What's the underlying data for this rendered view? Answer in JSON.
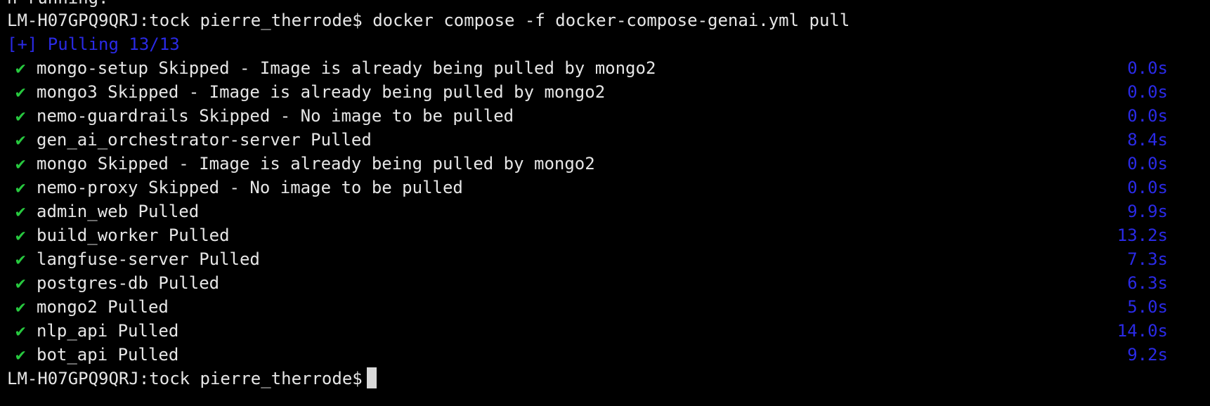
{
  "terminal": {
    "partial_top_line": "n running.",
    "command_line": {
      "prompt": "LM-H07GPQ9QRJ:tock pierre_therrode$",
      "command": "docker compose -f docker-compose-genai.yml pull"
    },
    "pulling_status": "[+] Pulling 13/13",
    "rows": [
      {
        "text": "mongo-setup Skipped - Image is already being pulled by mongo2",
        "duration": "0.0s"
      },
      {
        "text": "mongo3 Skipped - Image is already being pulled by mongo2",
        "duration": "0.0s"
      },
      {
        "text": "nemo-guardrails Skipped - No image to be pulled",
        "duration": "0.0s"
      },
      {
        "text": "gen_ai_orchestrator-server Pulled",
        "duration": "8.4s"
      },
      {
        "text": "mongo Skipped - Image is already being pulled by mongo2",
        "duration": "0.0s"
      },
      {
        "text": "nemo-proxy Skipped - No image to be pulled",
        "duration": "0.0s"
      },
      {
        "text": "admin_web Pulled",
        "duration": "9.9s"
      },
      {
        "text": "build_worker Pulled",
        "duration": "13.2s"
      },
      {
        "text": "langfuse-server Pulled",
        "duration": "7.3s"
      },
      {
        "text": "postgres-db Pulled",
        "duration": "6.3s"
      },
      {
        "text": "mongo2 Pulled",
        "duration": "5.0s"
      },
      {
        "text": "nlp_api Pulled",
        "duration": "14.0s"
      },
      {
        "text": "bot_api Pulled",
        "duration": "9.2s"
      }
    ],
    "check_glyph": "✔",
    "final_prompt": "LM-H07GPQ9QRJ:tock pierre_therrode$",
    "colors": {
      "background": "#000000",
      "text": "#e6e6e6",
      "check": "#27c93f",
      "accent_blue": "#2a2ae6",
      "cursor": "#d9d9d9"
    }
  }
}
